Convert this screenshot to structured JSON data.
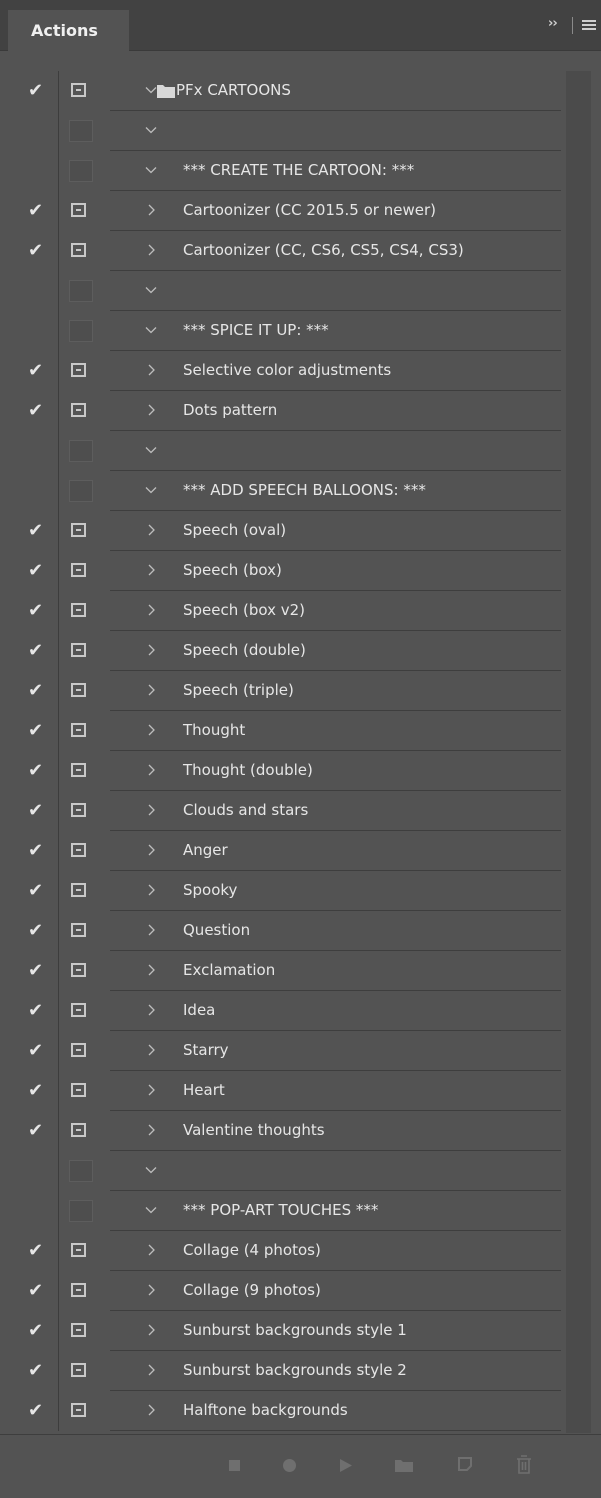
{
  "panel": {
    "tab_label": "Actions",
    "collapse_label": "››"
  },
  "actions": [
    {
      "label": "PFx CARTOONS",
      "kind": "set",
      "enabled": true,
      "dialog": true,
      "expanded": true
    },
    {
      "label": "",
      "kind": "blank",
      "enabled": false,
      "dialog": false,
      "expanded": true
    },
    {
      "label": "*** CREATE THE CARTOON: ***",
      "kind": "action",
      "enabled": false,
      "dialog": false,
      "expanded": true
    },
    {
      "label": "Cartoonizer (CC 2015.5 or newer)",
      "kind": "action",
      "enabled": true,
      "dialog": true,
      "expanded": false
    },
    {
      "label": "Cartoonizer (CC, CS6, CS5, CS4, CS3)",
      "kind": "action",
      "enabled": true,
      "dialog": true,
      "expanded": false
    },
    {
      "label": "",
      "kind": "blank",
      "enabled": false,
      "dialog": false,
      "expanded": true
    },
    {
      "label": "*** SPICE IT UP: ***",
      "kind": "action",
      "enabled": false,
      "dialog": false,
      "expanded": true
    },
    {
      "label": "Selective color adjustments",
      "kind": "action",
      "enabled": true,
      "dialog": true,
      "expanded": false
    },
    {
      "label": "Dots pattern",
      "kind": "action",
      "enabled": true,
      "dialog": true,
      "expanded": false
    },
    {
      "label": "",
      "kind": "blank",
      "enabled": false,
      "dialog": false,
      "expanded": true
    },
    {
      "label": "*** ADD SPEECH BALLOONS: ***",
      "kind": "action",
      "enabled": false,
      "dialog": false,
      "expanded": true
    },
    {
      "label": "Speech (oval)",
      "kind": "action",
      "enabled": true,
      "dialog": true,
      "expanded": false
    },
    {
      "label": "Speech (box)",
      "kind": "action",
      "enabled": true,
      "dialog": true,
      "expanded": false
    },
    {
      "label": "Speech (box v2)",
      "kind": "action",
      "enabled": true,
      "dialog": true,
      "expanded": false
    },
    {
      "label": "Speech (double)",
      "kind": "action",
      "enabled": true,
      "dialog": true,
      "expanded": false
    },
    {
      "label": "Speech (triple)",
      "kind": "action",
      "enabled": true,
      "dialog": true,
      "expanded": false
    },
    {
      "label": "Thought",
      "kind": "action",
      "enabled": true,
      "dialog": true,
      "expanded": false
    },
    {
      "label": "Thought (double)",
      "kind": "action",
      "enabled": true,
      "dialog": true,
      "expanded": false
    },
    {
      "label": "Clouds and stars",
      "kind": "action",
      "enabled": true,
      "dialog": true,
      "expanded": false
    },
    {
      "label": "Anger",
      "kind": "action",
      "enabled": true,
      "dialog": true,
      "expanded": false
    },
    {
      "label": "Spooky",
      "kind": "action",
      "enabled": true,
      "dialog": true,
      "expanded": false
    },
    {
      "label": "Question",
      "kind": "action",
      "enabled": true,
      "dialog": true,
      "expanded": false
    },
    {
      "label": "Exclamation",
      "kind": "action",
      "enabled": true,
      "dialog": true,
      "expanded": false
    },
    {
      "label": "Idea",
      "kind": "action",
      "enabled": true,
      "dialog": true,
      "expanded": false
    },
    {
      "label": "Starry",
      "kind": "action",
      "enabled": true,
      "dialog": true,
      "expanded": false
    },
    {
      "label": "Heart",
      "kind": "action",
      "enabled": true,
      "dialog": true,
      "expanded": false
    },
    {
      "label": "Valentine thoughts",
      "kind": "action",
      "enabled": true,
      "dialog": true,
      "expanded": false
    },
    {
      "label": "",
      "kind": "blank",
      "enabled": false,
      "dialog": false,
      "expanded": true
    },
    {
      "label": "*** POP-ART  TOUCHES ***",
      "kind": "action",
      "enabled": false,
      "dialog": false,
      "expanded": true
    },
    {
      "label": "Collage (4 photos)",
      "kind": "action",
      "enabled": true,
      "dialog": true,
      "expanded": false
    },
    {
      "label": "Collage (9 photos)",
      "kind": "action",
      "enabled": true,
      "dialog": true,
      "expanded": false
    },
    {
      "label": "Sunburst backgrounds style 1",
      "kind": "action",
      "enabled": true,
      "dialog": true,
      "expanded": false
    },
    {
      "label": "Sunburst backgrounds style 2",
      "kind": "action",
      "enabled": true,
      "dialog": true,
      "expanded": false
    },
    {
      "label": "Halftone backgrounds",
      "kind": "action",
      "enabled": true,
      "dialog": true,
      "expanded": false
    }
  ],
  "toolbar": {
    "buttons": [
      {
        "name": "stop-button",
        "icon": "stop-icon"
      },
      {
        "name": "record-button",
        "icon": "record-icon"
      },
      {
        "name": "play-button",
        "icon": "play-icon"
      },
      {
        "name": "new-set-button",
        "icon": "folder-icon"
      },
      {
        "name": "new-action-button",
        "icon": "new-item-icon"
      },
      {
        "name": "delete-button",
        "icon": "trash-icon"
      }
    ]
  },
  "colors": {
    "panel_bg": "#535353",
    "tabbar_bg": "#424242",
    "text": "#e6e6e6",
    "icon": "#c8c8c8",
    "toolbar_icon": "#6f6f6f"
  }
}
